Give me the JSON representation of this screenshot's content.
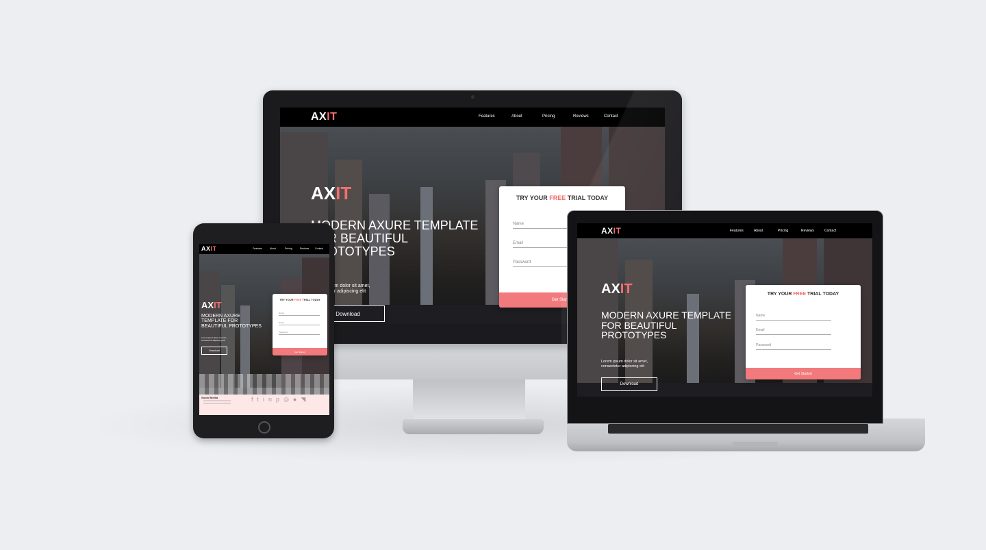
{
  "brand": {
    "prefix": "AX",
    "accent": "IT",
    "accent_color": "#f46f6f"
  },
  "nav": [
    "Features",
    "About",
    "Pricing",
    "Reviews",
    "Contact"
  ],
  "hero": {
    "imac_headline_lines": [
      "MODERN AXURE TEMPLATE",
      "FOR BEAUTIFUL",
      "PROTOTYPES"
    ],
    "mb_headline_lines": [
      "MODERN AXURE TEMPLATE",
      "FOR BEAUTIFUL",
      "PROTOTYPES"
    ],
    "ipad_headline_lines": [
      "MODERN AXURE",
      "TEMPLATE FOR",
      "BEAUTIFUL PROTOTYPES"
    ],
    "lorem_lines": [
      "Lorem ipsum dolor sit amet,",
      "consectetur adipiscing elit"
    ],
    "download": "Download"
  },
  "form": {
    "title_pre": "TRY YOUR",
    "title_free": "FREE",
    "title_post": "TRIAL TODAY",
    "name": "Name",
    "email": "Email",
    "password": "Password",
    "cta": "Get Started",
    "cta_color": "#f27a7d"
  },
  "social": {
    "label": "Social Media",
    "icons": [
      "facebook-icon",
      "twitter-icon",
      "linkedin-icon",
      "pinterest-icon",
      "instagram-icon",
      "github-icon",
      "rss-icon"
    ]
  }
}
